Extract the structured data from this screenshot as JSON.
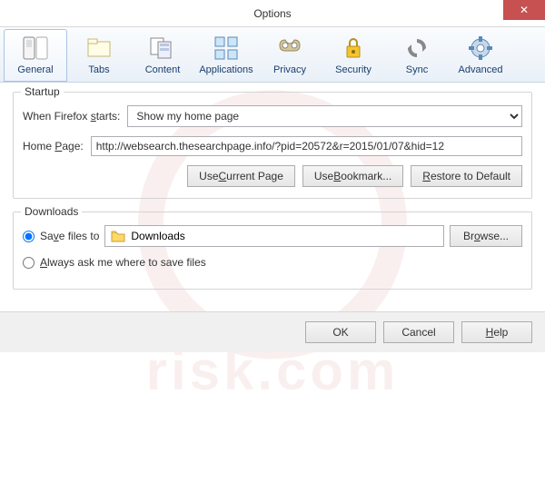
{
  "window": {
    "title": "Options"
  },
  "toolbar": [
    {
      "label": "General",
      "selected": true
    },
    {
      "label": "Tabs"
    },
    {
      "label": "Content"
    },
    {
      "label": "Applications"
    },
    {
      "label": "Privacy"
    },
    {
      "label": "Security"
    },
    {
      "label": "Sync"
    },
    {
      "label": "Advanced"
    }
  ],
  "startup": {
    "legend": "Startup",
    "when_label_pre": "When Firefox ",
    "when_label_u": "s",
    "when_label_post": "tarts:",
    "when_value": "Show my home page",
    "homepage_label_pre": "Home ",
    "homepage_label_u": "P",
    "homepage_label_post": "age:",
    "homepage_value": "http://websearch.thesearchpage.info/?pid=20572&r=2015/01/07&hid=12",
    "btn_current_pre": "Use ",
    "btn_current_u": "C",
    "btn_current_post": "urrent Page",
    "btn_bookmark_pre": "Use ",
    "btn_bookmark_u": "B",
    "btn_bookmark_post": "ookmark...",
    "btn_restore_u": "R",
    "btn_restore_post": "estore to Default"
  },
  "downloads": {
    "legend": "Downloads",
    "save_pre": "Sa",
    "save_u": "v",
    "save_post": "e files to",
    "folder": "Downloads",
    "browse_pre": "Br",
    "browse_u": "o",
    "browse_post": "wse...",
    "ask_u": "A",
    "ask_post": "lways ask me where to save files"
  },
  "buttons": {
    "ok": "OK",
    "cancel": "Cancel",
    "help_u": "H",
    "help_post": "elp"
  },
  "watermark": "risk.com"
}
